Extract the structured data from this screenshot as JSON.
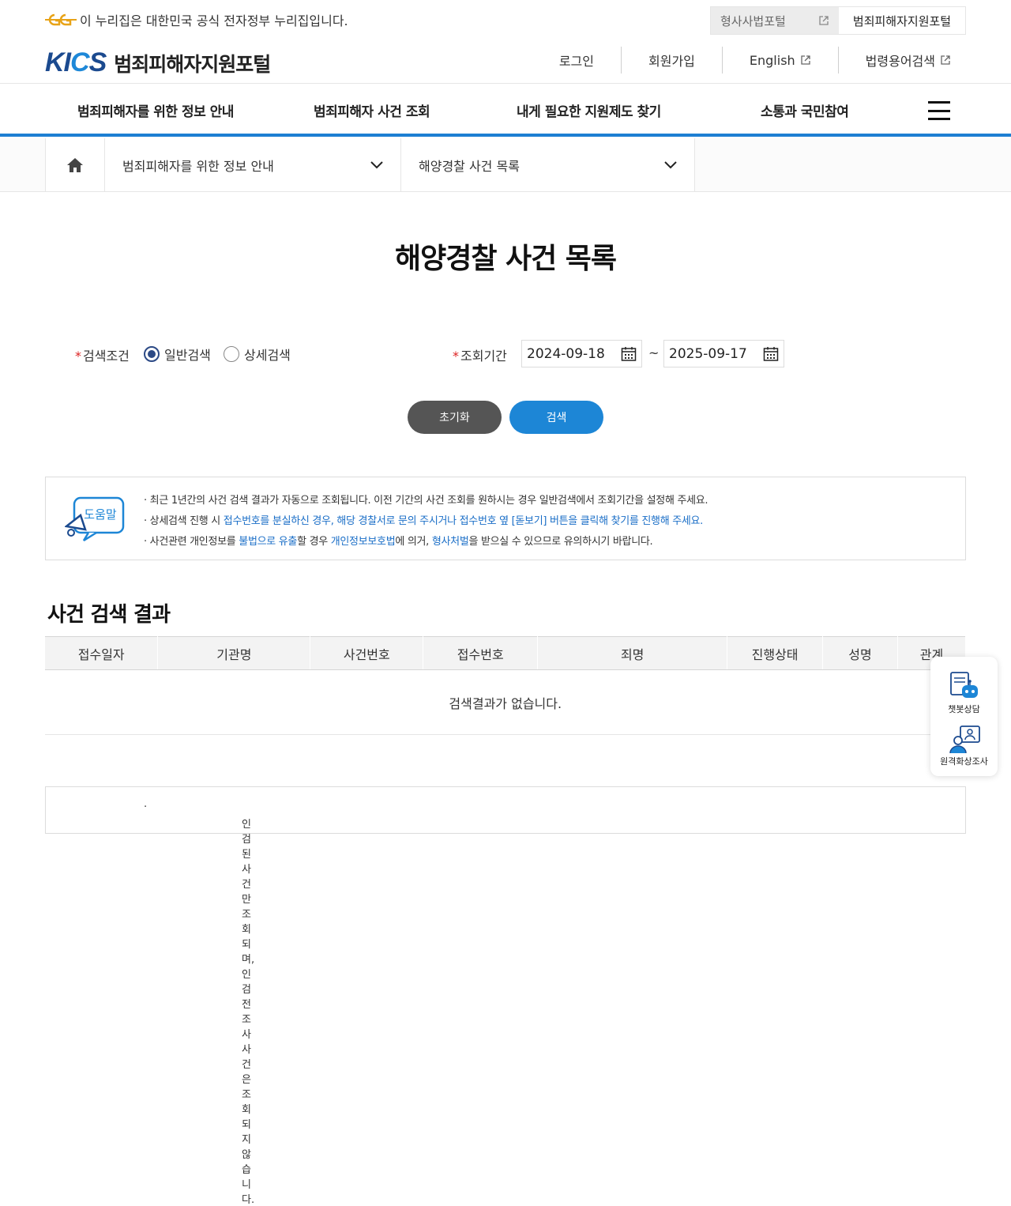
{
  "gov_bar": {
    "notice": "이 누리집은 대한민국 공식 전자정부 누리집입니다.",
    "links": [
      {
        "label": "형사사법포털"
      },
      {
        "label": "범죄피해자지원포털"
      }
    ]
  },
  "header": {
    "logo_text": "KICS",
    "site_name": "범죄피해자지원포털",
    "util": [
      {
        "label": "로그인"
      },
      {
        "label": "회원가입"
      },
      {
        "label": "English"
      },
      {
        "label": "법령용어검색"
      }
    ]
  },
  "gnb": [
    {
      "label": "범죄피해자를 위한 정보 안내"
    },
    {
      "label": "범죄피해자 사건 조회"
    },
    {
      "label": "내게 필요한 지원제도 찾기"
    },
    {
      "label": "소통과 국민참여"
    }
  ],
  "breadcrumb": {
    "level1": "범죄피해자를 위한 정보 안내",
    "level2": "해양경찰 사건 목록"
  },
  "page_title": "해양경찰 사건 목록",
  "search": {
    "condition_label": "검색조건",
    "radio_general": "일반검색",
    "radio_detail": "상세검색",
    "selected": "일반검색",
    "period_label": "조회기간",
    "date_from": "2024-09-18",
    "date_to": "2025-09-17",
    "tilde": "~",
    "reset_label": "초기화",
    "search_label": "검색"
  },
  "help": {
    "icon_text": "도움말",
    "line1": "최근 1년간의 사건 검색 결과가 자동으로 조회됩니다. 이전 기간의 사건 조회를 원하시는 경우 일반검색에서 조회기간을 설정해 주세요.",
    "line2_a": "상세검색 진행 시 ",
    "line2_b": "접수번호를 분실하신 경우, 해당 경찰서로 문의 주시거나 접수번호 옆 [돋보기] 버튼을 클릭해 찾기를 진행해 주세요.",
    "line3_a": "사건관련 개인정보를 ",
    "line3_b": "불법으로 유출",
    "line3_c": "할 경우 ",
    "line3_d": "개인정보보호법",
    "line3_e": "에 의거, ",
    "line3_f": "형사처벌",
    "line3_g": "을 받으실 수 있으므로 유의하시기 바랍니다."
  },
  "results": {
    "title": "사건 검색 결과",
    "columns": [
      "접수일자",
      "기관명",
      "사건번호",
      "접수번호",
      "죄명",
      "진행상태",
      "성명",
      "관계"
    ],
    "empty_message": "검색결과가 없습니다."
  },
  "help2": {
    "line1": "인검된 사건만 조회되며, 인검 전 조사 사건은 조회되지 않습니다."
  },
  "quick_menu": [
    {
      "label": "챗봇상담",
      "icon": "chatbot-icon"
    },
    {
      "label": "원격화상조사",
      "icon": "video-call-icon"
    }
  ],
  "colors": {
    "accent": "#1d86d6",
    "brand": "#1b4a8f",
    "link": "#1a6ec7",
    "required": "#dd2222"
  }
}
